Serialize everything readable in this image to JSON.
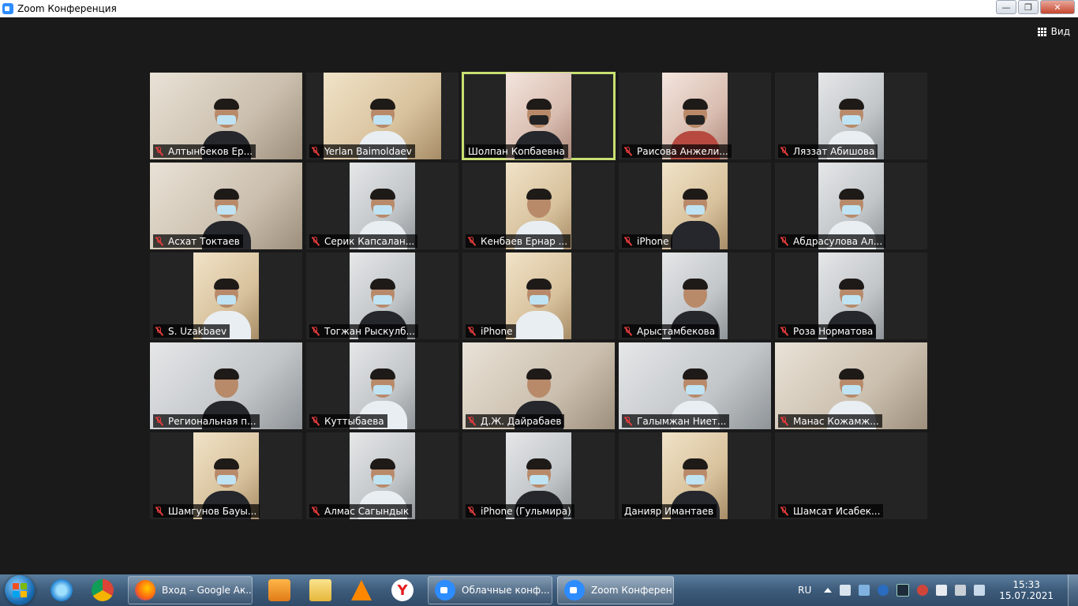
{
  "window": {
    "title": "Zoom Конференция"
  },
  "view_button": {
    "label": "Вид"
  },
  "participants": [
    {
      "name": "Алтынбеков Ер...",
      "muted": true,
      "active": false
    },
    {
      "name": "Yerlan Baimoldaev",
      "muted": true,
      "active": false
    },
    {
      "name": "Шолпан Копбаевна",
      "muted": false,
      "active": true
    },
    {
      "name": "Раисова Анжели...",
      "muted": true,
      "active": false
    },
    {
      "name": "Ляззат Абишова",
      "muted": true,
      "active": false
    },
    {
      "name": "Асхат Токтаев",
      "muted": true,
      "active": false
    },
    {
      "name": "Серик Капсалан...",
      "muted": true,
      "active": false
    },
    {
      "name": "Кенбаев Ернар ...",
      "muted": true,
      "active": false
    },
    {
      "name": "iPhone",
      "muted": true,
      "active": false
    },
    {
      "name": "Абдрасулова Ал...",
      "muted": true,
      "active": false
    },
    {
      "name": "S. Uzakbaev",
      "muted": true,
      "active": false
    },
    {
      "name": "Тогжан Рыскулб...",
      "muted": true,
      "active": false
    },
    {
      "name": "iPhone",
      "muted": true,
      "active": false
    },
    {
      "name": "Арыстамбекова",
      "muted": true,
      "active": false
    },
    {
      "name": "Роза Норматова",
      "muted": true,
      "active": false
    },
    {
      "name": "Региональная п...",
      "muted": true,
      "active": false
    },
    {
      "name": "Куттыбаева",
      "muted": true,
      "active": false
    },
    {
      "name": "Д.Ж. Дайрабаев",
      "muted": true,
      "active": false
    },
    {
      "name": "Галымжан Ниет...",
      "muted": true,
      "active": false
    },
    {
      "name": "Манас Кожамж...",
      "muted": true,
      "active": false
    },
    {
      "name": "Шамгунов Бауы...",
      "muted": true,
      "active": false
    },
    {
      "name": "Алмас Сагындык",
      "muted": true,
      "active": false
    },
    {
      "name": "iPhone (Гульмира)",
      "muted": true,
      "active": false
    },
    {
      "name": "Данияр Имантаев",
      "muted": false,
      "active": false
    },
    {
      "name": "Шамсат Исабек...",
      "muted": true,
      "active": false
    }
  ],
  "taskbar": {
    "tasks": [
      {
        "label": "Вход – Google Ак...",
        "icon": "firefox-icon"
      },
      {
        "label": "Облачные конф...",
        "icon": "zoom-icon"
      },
      {
        "label": "Zoom Конферен...",
        "icon": "zoom-icon"
      }
    ],
    "pinned": [
      "internet-explorer-icon",
      "chrome-icon",
      "media-player-icon",
      "file-explorer-icon",
      "vlc-icon",
      "yandex-icon"
    ],
    "language": "RU",
    "time": "15:33",
    "date": "15.07.2021"
  },
  "colors": {
    "active_speaker_border": "#c8e071",
    "muted_mic": "#e23b3b",
    "zoom_blue": "#2d8cff"
  }
}
